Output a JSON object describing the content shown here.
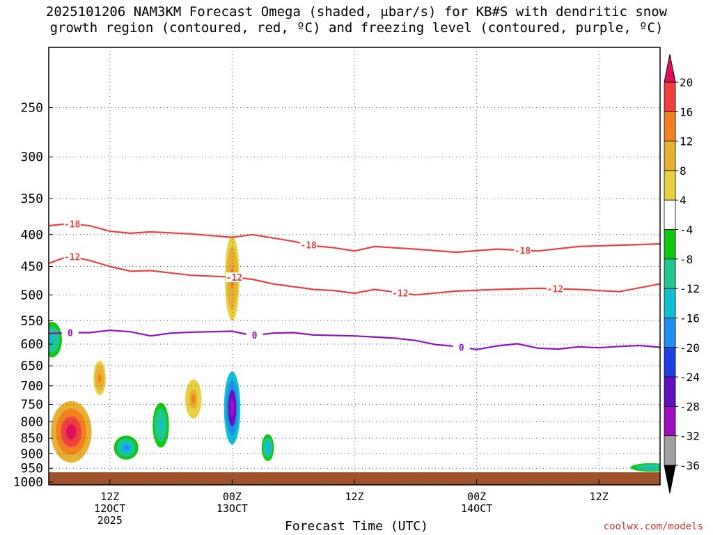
{
  "title_line1": "2025101206 NAM3KM Forecast Omega (shaded, μbar/s) for KB#S with dendritic snow",
  "title_line2": "growth region (contoured, red, ºC) and freezing level (contoured, purple, ºC)",
  "credit": "coolwx.com/models",
  "chart_data": {
    "type": "heatmap",
    "xlabel": "Forecast Time (UTC)",
    "ylabel": "",
    "x_ticks": [
      {
        "hour": 6,
        "label": "12Z",
        "date": "12OCT",
        "year": "2025"
      },
      {
        "hour": 18,
        "label": "00Z",
        "date": "13OCT",
        "year": ""
      },
      {
        "hour": 30,
        "label": "12Z",
        "date": "",
        "year": ""
      },
      {
        "hour": 42,
        "label": "00Z",
        "date": "14OCT",
        "year": ""
      },
      {
        "hour": 54,
        "label": "12Z",
        "date": "",
        "year": ""
      }
    ],
    "xlim": [
      0,
      60
    ],
    "ylim": [
      1010,
      200
    ],
    "y_ticks": [
      250,
      300,
      350,
      400,
      450,
      500,
      550,
      600,
      650,
      700,
      750,
      800,
      850,
      900,
      950,
      1000
    ],
    "colorbar": {
      "unit": "μbar/s",
      "labels": [
        "20",
        "16",
        "12",
        "8",
        "4",
        "-4",
        "-8",
        "-12",
        "-16",
        "-20",
        "-24",
        "-28",
        "-32",
        "-36"
      ],
      "colors": [
        "#e0105a",
        "#f04040",
        "#f08020",
        "#e8b030",
        "#e8d040",
        "#ffffff",
        "#10c810",
        "#20c890",
        "#10c0d0",
        "#2090f0",
        "#2040e0",
        "#6010c0",
        "#a010c0",
        "#a0a0a0",
        "#000000"
      ]
    },
    "contours": [
      {
        "value": "-18",
        "color": "#e84040",
        "points": [
          [
            0,
            387
          ],
          [
            2,
            384
          ],
          [
            4,
            387
          ],
          [
            6,
            395
          ],
          [
            8,
            398
          ],
          [
            10,
            396
          ],
          [
            14,
            399
          ],
          [
            18,
            404
          ],
          [
            20,
            400
          ],
          [
            24,
            410
          ],
          [
            26,
            417
          ],
          [
            28,
            420
          ],
          [
            30,
            425
          ],
          [
            32,
            418
          ],
          [
            36,
            422
          ],
          [
            40,
            427
          ],
          [
            44,
            422
          ],
          [
            48,
            425
          ],
          [
            52,
            418
          ],
          [
            56,
            416
          ],
          [
            60,
            414
          ]
        ],
        "label_x": [
          2.3,
          25.5,
          46.5
        ]
      },
      {
        "value": "-12",
        "color": "#e84040",
        "points": [
          [
            0,
            445
          ],
          [
            2,
            433
          ],
          [
            4,
            440
          ],
          [
            6,
            450
          ],
          [
            8,
            458
          ],
          [
            10,
            457
          ],
          [
            14,
            465
          ],
          [
            18,
            468
          ],
          [
            20,
            472
          ],
          [
            22,
            480
          ],
          [
            24,
            485
          ],
          [
            26,
            490
          ],
          [
            28,
            492
          ],
          [
            30,
            497
          ],
          [
            32,
            490
          ],
          [
            36,
            500
          ],
          [
            40,
            493
          ],
          [
            44,
            490
          ],
          [
            48,
            488
          ],
          [
            52,
            490
          ],
          [
            56,
            494
          ],
          [
            60,
            480
          ]
        ],
        "label_x": [
          2.3,
          18.2,
          34.5,
          49.7
        ]
      },
      {
        "value": "0",
        "color": "#9010c0",
        "points": [
          [
            0,
            577
          ],
          [
            2,
            575
          ],
          [
            4,
            575
          ],
          [
            6,
            570
          ],
          [
            8,
            573
          ],
          [
            10,
            582
          ],
          [
            12,
            576
          ],
          [
            14,
            574
          ],
          [
            16,
            573
          ],
          [
            18,
            572
          ],
          [
            20,
            581
          ],
          [
            22,
            576
          ],
          [
            24,
            575
          ],
          [
            26,
            580
          ],
          [
            30,
            582
          ],
          [
            34,
            587
          ],
          [
            36,
            592
          ],
          [
            38,
            601
          ],
          [
            40,
            605
          ],
          [
            42,
            612
          ],
          [
            44,
            604
          ],
          [
            46,
            599
          ],
          [
            48,
            609
          ],
          [
            50,
            611
          ],
          [
            52,
            606
          ],
          [
            54,
            608
          ],
          [
            56,
            605
          ],
          [
            58,
            603
          ],
          [
            60,
            607
          ]
        ],
        "label_x": [
          2.1,
          20.2,
          40.5
        ]
      }
    ],
    "omega_cells": [
      {
        "x": 0.3,
        "p": 590,
        "rx": 1.0,
        "rp": 40,
        "v": -14
      },
      {
        "x": 2.2,
        "p": 830,
        "rx": 2.0,
        "rp": 100,
        "v": 22
      },
      {
        "x": 5.0,
        "p": 680,
        "rx": 0.6,
        "rp": 45,
        "v": 14
      },
      {
        "x": 7.6,
        "p": 880,
        "rx": 1.2,
        "rp": 40,
        "v": -20
      },
      {
        "x": 11.0,
        "p": 810,
        "rx": 0.8,
        "rp": 70,
        "v": -14
      },
      {
        "x": 14.2,
        "p": 735,
        "rx": 0.8,
        "rp": 55,
        "v": 12
      },
      {
        "x": 18.0,
        "p": 760,
        "rx": 0.8,
        "rp": 110,
        "v": -32
      },
      {
        "x": 18.0,
        "p": 470,
        "rx": 0.7,
        "rp": 80,
        "v": 14
      },
      {
        "x": 21.5,
        "p": 880,
        "rx": 0.6,
        "rp": 45,
        "v": -16
      },
      {
        "x": 59.1,
        "p": 947,
        "rx": 2.0,
        "rp": 15,
        "v": -14
      }
    ]
  }
}
